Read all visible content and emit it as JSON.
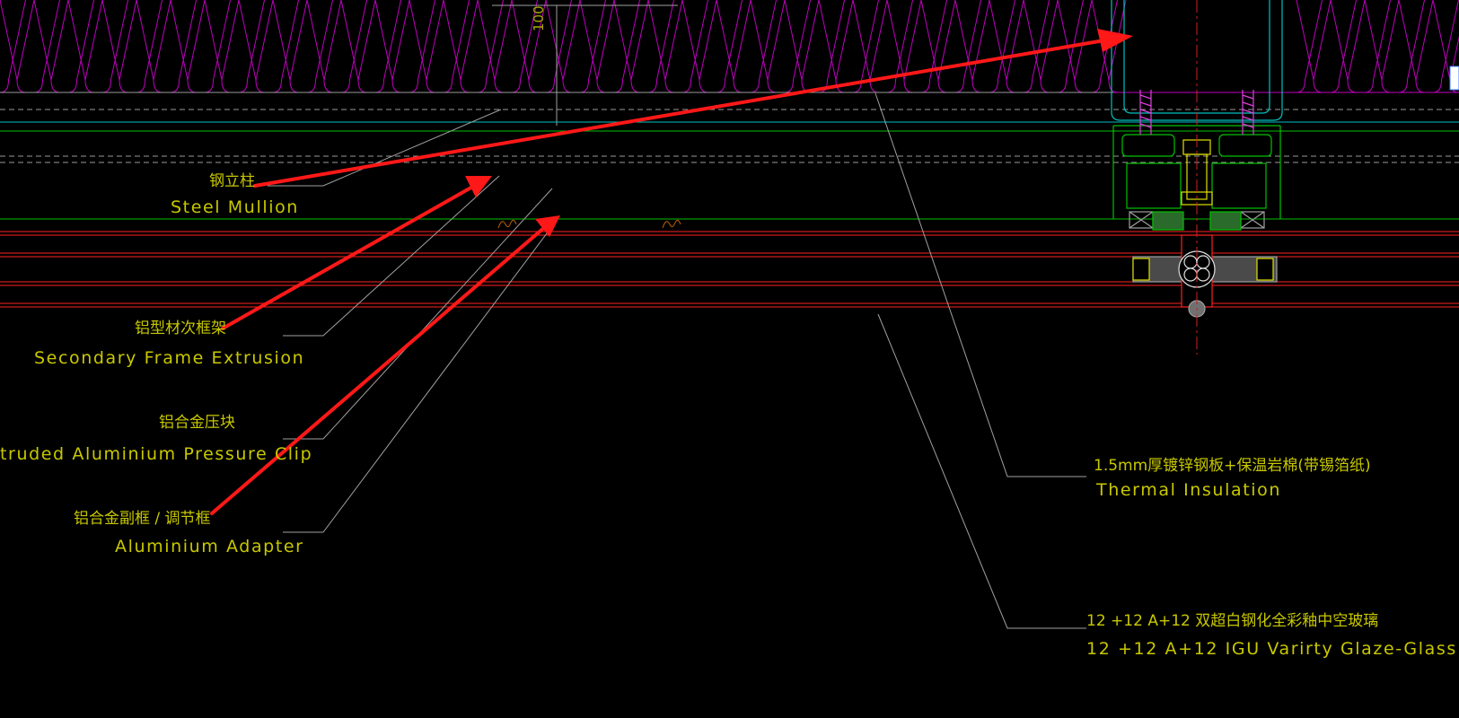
{
  "drawing": {
    "background": "#000000",
    "dimension_value": "100",
    "colors": {
      "insulation": "#c000c0",
      "cyan_line": "#00c0c0",
      "green_line": "#00c000",
      "red_line": "#ff2020",
      "leader": "#a0a0a0",
      "text": "#c8c800",
      "markup_arrow": "#ff1818",
      "center_line": "#d02020"
    }
  },
  "labels": {
    "steel_mullion": {
      "zh": "钢立柱",
      "en": "Steel Mullion"
    },
    "secondary_frame": {
      "zh": "铝型材次框架",
      "en": "Secondary Frame Extrusion"
    },
    "pressure_clip": {
      "zh": "铝合金压块",
      "en": "truded Aluminium Pressure Clip"
    },
    "adapter": {
      "zh": "铝合金副框 /  调节框",
      "en": "Aluminium Adapter"
    },
    "thermal_insulation": {
      "zh": "1.5mm厚镀锌钢板+保温岩棉(带锡箔纸)",
      "en": "Thermal Insulation"
    },
    "glass": {
      "zh": "12 +12 A+12  双超白钢化全彩釉中空玻璃",
      "en": "12 +12 A+12  IGU Varirty Glaze-Glass"
    }
  }
}
